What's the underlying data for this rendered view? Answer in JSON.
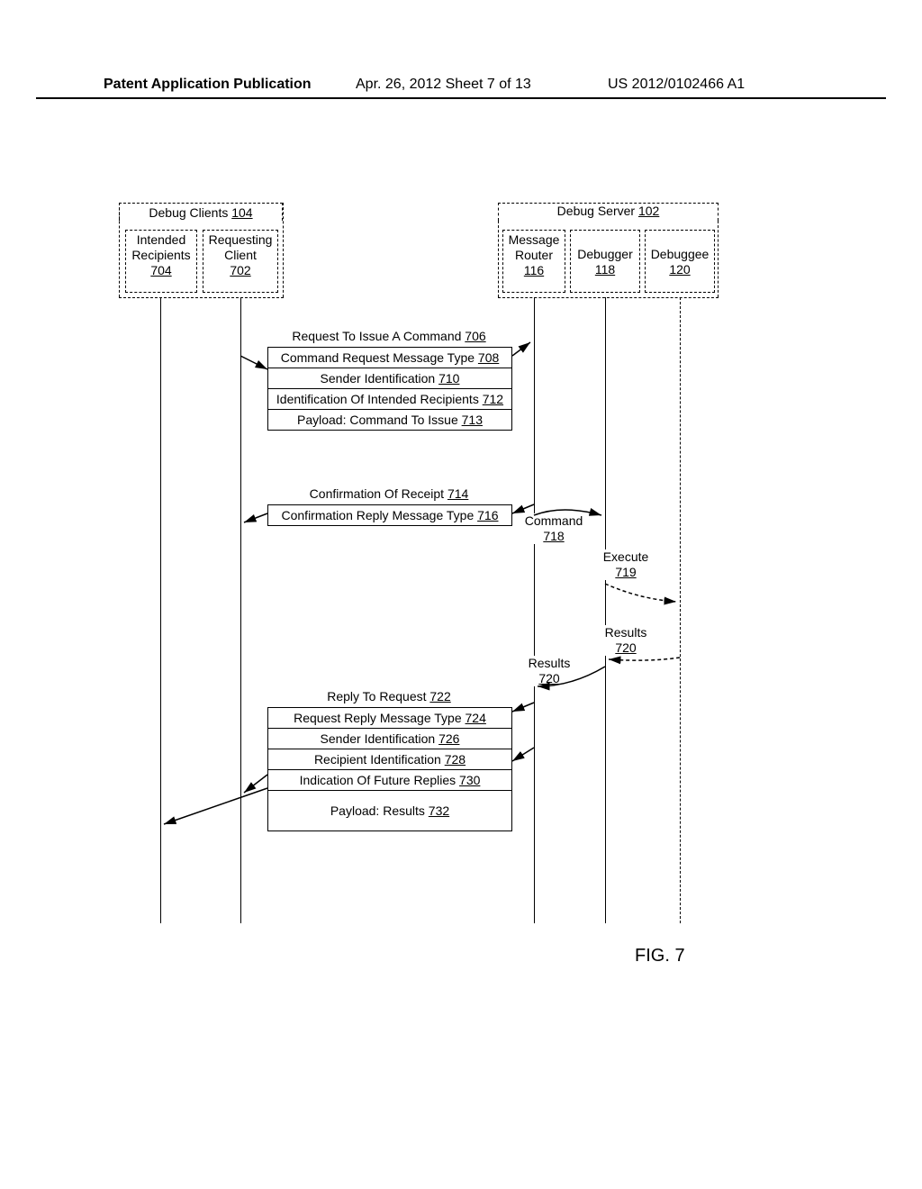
{
  "header": {
    "left": "Patent Application Publication",
    "mid": "Apr. 26, 2012  Sheet 7 of 13",
    "right": "US 2012/0102466 A1"
  },
  "clients_group": {
    "title": "Debug Clients",
    "num": "104"
  },
  "intended": {
    "title": "Intended Recipients",
    "num": "704"
  },
  "requesting": {
    "title": "Requesting Client",
    "num": "702"
  },
  "server_group": {
    "title": "Debug Server",
    "num": "102"
  },
  "router": {
    "title": "Message Router",
    "num": "116"
  },
  "debugger": {
    "title": "Debugger",
    "num": "118"
  },
  "debuggee": {
    "title": "Debuggee",
    "num": "120"
  },
  "req_title": {
    "text": "Request To Issue A Command",
    "num": "706"
  },
  "req_rows": [
    {
      "text": "Command Request Message Type",
      "num": "708"
    },
    {
      "text": "Sender Identification",
      "num": "710"
    },
    {
      "text": "Identification Of Intended Recipients",
      "num": "712"
    },
    {
      "text": "Payload: Command To Issue",
      "num": "713"
    }
  ],
  "conf_title": {
    "text": "Confirmation Of Receipt",
    "num": "714"
  },
  "conf_rows": [
    {
      "text": "Confirmation Reply Message Type",
      "num": "716"
    }
  ],
  "command": {
    "text": "Command",
    "num": "718"
  },
  "execute": {
    "text": "Execute",
    "num": "719"
  },
  "results1": {
    "text": "Results",
    "num": "720"
  },
  "results2": {
    "text": "Results",
    "num": "720"
  },
  "reply_title": {
    "text": "Reply To Request",
    "num": "722"
  },
  "reply_rows": [
    {
      "text": "Request Reply Message Type",
      "num": "724"
    },
    {
      "text": "Sender Identification",
      "num": "726"
    },
    {
      "text": "Recipient Identification",
      "num": "728"
    },
    {
      "text": "Indication Of Future Replies",
      "num": "730"
    },
    {
      "text": "Payload: Results",
      "num": "732"
    }
  ],
  "fig": "FIG. 7"
}
